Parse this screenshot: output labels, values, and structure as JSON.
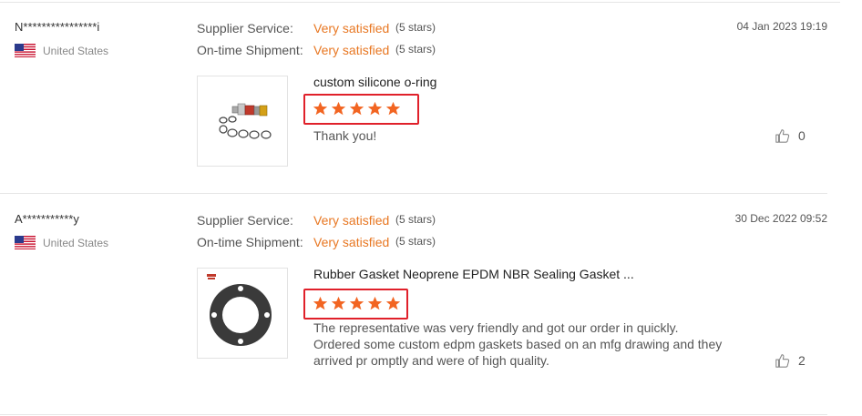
{
  "reviews": [
    {
      "buyer": "N****************i",
      "country": "United States",
      "supplier_service_label": "Supplier Service:",
      "supplier_service_value": "Very satisfied",
      "supplier_service_stars": "(5 stars)",
      "shipment_label": "On-time Shipment:",
      "shipment_value": "Very satisfied",
      "shipment_stars": "(5 stars)",
      "date": "04 Jan 2023 19:19",
      "product_title": "custom silicone o-ring",
      "rating": 5,
      "comment": "Thank you!",
      "likes": "0"
    },
    {
      "buyer": "A***********y",
      "country": "United States",
      "supplier_service_label": "Supplier Service:",
      "supplier_service_value": "Very satisfied",
      "supplier_service_stars": "(5 stars)",
      "shipment_label": "On-time Shipment:",
      "shipment_value": "Very satisfied",
      "shipment_stars": "(5 stars)",
      "date": "30 Dec 2022 09:52",
      "product_title": "Rubber Gasket Neoprene EPDM NBR Sealing Gasket ...",
      "rating": 5,
      "comment": "The representative was very friendly and got our order in quickly. Ordered some custom edpm gaskets based on an mfg drawing and they arrived pr omptly and were of high quality.",
      "likes": "2"
    }
  ],
  "colors": {
    "accent": "#e87722",
    "star": "#f26522",
    "highlight_box": "#e0202a",
    "divider": "#e6e6e6"
  },
  "icons": {
    "flag": "us-flag-icon",
    "like": "thumbs-up-icon",
    "star": "star-icon"
  }
}
